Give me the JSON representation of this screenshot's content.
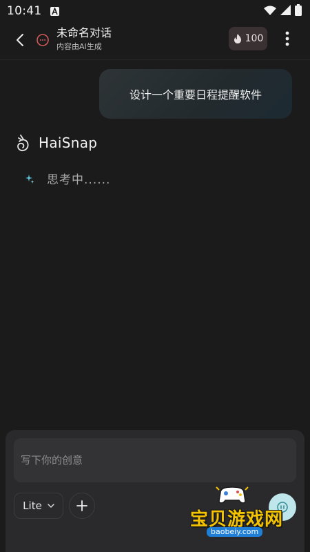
{
  "status_bar": {
    "time": "10:41",
    "icons": [
      "notification-a-icon",
      "wifi-icon",
      "signal-icon",
      "battery-icon"
    ]
  },
  "header": {
    "title": "未命名对话",
    "subtitle": "内容由AI生成",
    "credits": "100",
    "icons": [
      "back-arrow-icon",
      "chat-bubble-icon",
      "flame-icon",
      "more-vertical-icon"
    ]
  },
  "conversation": {
    "user_message": "设计一个重要日程提醒软件",
    "assistant_name": "HaiSnap",
    "status_text": "思考中......"
  },
  "composer": {
    "placeholder": "写下你的创意",
    "model": "Lite",
    "icons": [
      "chevron-down-icon",
      "plus-icon",
      "send-icon"
    ]
  },
  "watermark": {
    "text": "宝贝游戏网",
    "url": "baobeiy.com"
  },
  "colors": {
    "background": "#1b1b1c",
    "panel": "#2a2a2c",
    "send_button": "#bfe6ea",
    "credit_badge": "#3a3232",
    "watermark_yellow": "#f5c400"
  }
}
